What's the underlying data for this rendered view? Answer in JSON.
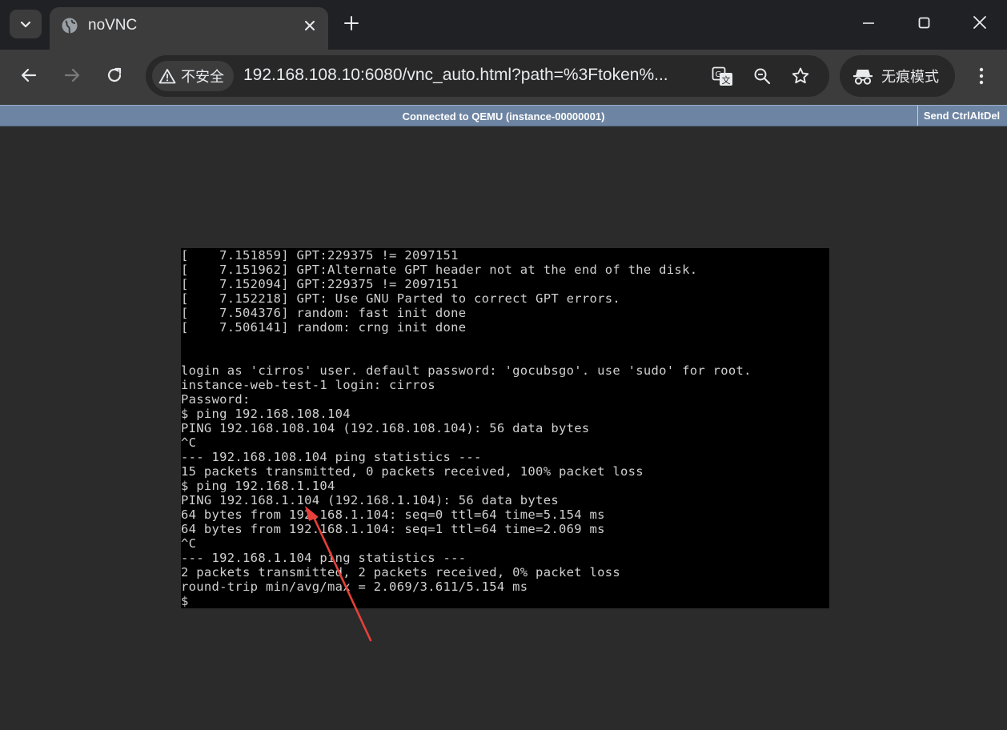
{
  "browser": {
    "tab_title": "noVNC",
    "security_label": "不安全",
    "url": "192.168.108.10:6080/vnc_auto.html?path=%3Ftoken%...",
    "incognito_label": "无痕模式"
  },
  "icons": {
    "tab_search": "chevron-down-icon",
    "favicon": "globe-icon",
    "tab_close": "close-icon",
    "new_tab": "plus-icon",
    "back": "arrow-left-icon",
    "forward": "arrow-right-icon",
    "reload": "reload-icon",
    "warning": "warning-icon",
    "translate": "translate-icon",
    "zoom": "zoom-icon",
    "bookmark": "star-icon",
    "incognito": "incognito-icon",
    "menu": "kebab-menu-icon",
    "minimize": "minimize-icon",
    "maximize": "maximize-icon",
    "close_window": "close-window-icon"
  },
  "novnc": {
    "status": "Connected to QEMU (instance-00000001)",
    "send_cad_label": "Send CtrlAltDel"
  },
  "terminal": {
    "lines": [
      "[    7.151859] GPT:229375 != 2097151",
      "[    7.151962] GPT:Alternate GPT header not at the end of the disk.",
      "[    7.152094] GPT:229375 != 2097151",
      "[    7.152218] GPT: Use GNU Parted to correct GPT errors.",
      "[    7.504376] random: fast init done",
      "[    7.506141] random: crng init done",
      "",
      "",
      "login as 'cirros' user. default password: 'gocubsgo'. use 'sudo' for root.",
      "instance-web-test-1 login: cirros",
      "Password:",
      "$ ping 192.168.108.104",
      "PING 192.168.108.104 (192.168.108.104): 56 data bytes",
      "^C",
      "--- 192.168.108.104 ping statistics ---",
      "15 packets transmitted, 0 packets received, 100% packet loss",
      "$ ping 192.168.1.104",
      "PING 192.168.1.104 (192.168.1.104): 56 data bytes",
      "64 bytes from 192.168.1.104: seq=0 ttl=64 time=5.154 ms",
      "64 bytes from 192.168.1.104: seq=1 ttl=64 time=2.069 ms",
      "^C",
      "--- 192.168.1.104 ping statistics ---",
      "2 packets transmitted, 2 packets received, 0% packet loss",
      "round-trip min/avg/max = 2.069/3.611/5.154 ms",
      "$"
    ]
  },
  "colors": {
    "annotation_arrow": "#e8403a",
    "status_bar": "#6d84a2"
  }
}
